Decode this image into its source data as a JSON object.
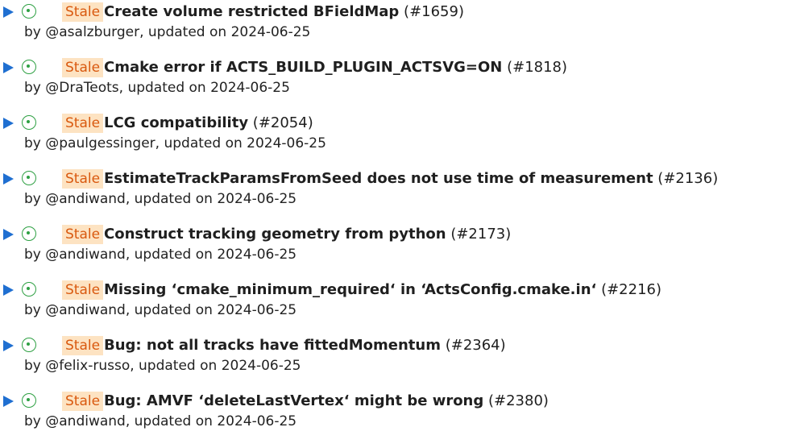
{
  "stale_label": "Stale",
  "colors": {
    "arrow": "#1f6fd1",
    "status_open": "#2ea043",
    "stale_bg": "#fde3c2",
    "stale_text": "#d9590f"
  },
  "issues": [
    {
      "title": "Create volume restricted BFieldMap",
      "number": "(#1659)",
      "meta": "by @asalzburger, updated on 2024-06-25"
    },
    {
      "title": "Cmake error if ACTS_BUILD_PLUGIN_ACTSVG=ON",
      "number": "(#1818)",
      "meta": "by @DraTeots, updated on 2024-06-25"
    },
    {
      "title": "LCG compatibility",
      "number": "(#2054)",
      "meta": "by @paulgessinger, updated on 2024-06-25"
    },
    {
      "title": "EstimateTrackParamsFromSeed does not use time of measurement",
      "number": "(#2136)",
      "meta": "by @andiwand, updated on 2024-06-25"
    },
    {
      "title": "Construct tracking geometry from python",
      "number": "(#2173)",
      "meta": "by @andiwand, updated on 2024-06-25"
    },
    {
      "title": "Missing ‘cmake_minimum_required‘ in ‘ActsConfig.cmake.in‘",
      "number": "(#2216)",
      "meta": "by @andiwand, updated on 2024-06-25"
    },
    {
      "title": "Bug: not all tracks have fittedMomentum",
      "number": "(#2364)",
      "meta": "by @felix-russo, updated on 2024-06-25"
    },
    {
      "title": "Bug: AMVF ‘deleteLastVertex‘ might be wrong",
      "number": "(#2380)",
      "meta": "by @andiwand, updated on 2024-06-25"
    }
  ]
}
